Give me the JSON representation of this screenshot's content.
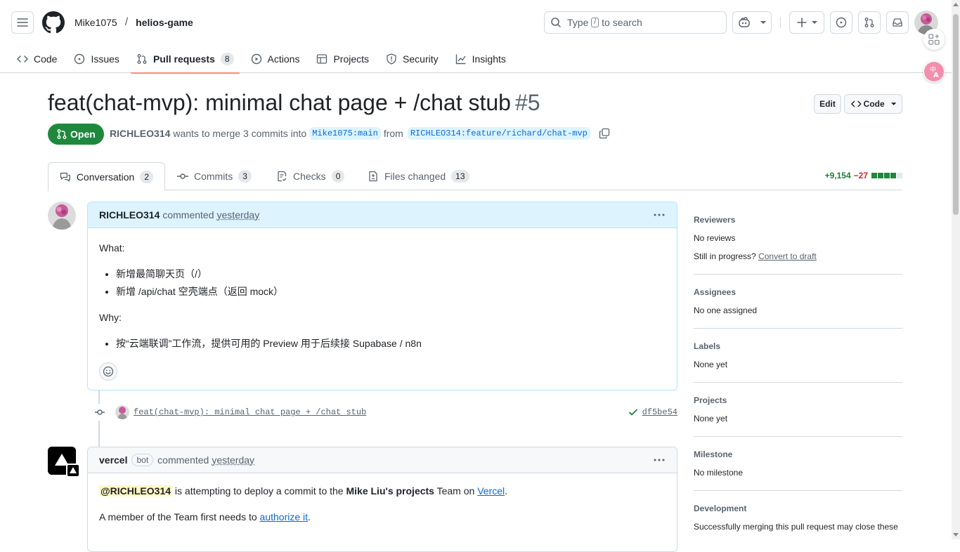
{
  "header": {
    "owner": "Mike1075",
    "separator": "/",
    "repo": "helios-game",
    "search": {
      "prefix": "Type",
      "key": "/",
      "suffix": "to search"
    }
  },
  "repo_tabs": [
    {
      "label": "Code",
      "icon": "code-icon"
    },
    {
      "label": "Issues",
      "icon": "issue-icon"
    },
    {
      "label": "Pull requests",
      "icon": "pull-request-icon",
      "count": "8",
      "active": true
    },
    {
      "label": "Actions",
      "icon": "play-icon"
    },
    {
      "label": "Projects",
      "icon": "table-icon"
    },
    {
      "label": "Security",
      "icon": "shield-icon"
    },
    {
      "label": "Insights",
      "icon": "graph-icon"
    }
  ],
  "pr": {
    "title": "feat(chat-mvp): minimal chat page + /chat stub",
    "number": "#5",
    "edit_label": "Edit",
    "code_label": "Code",
    "state": "Open",
    "author": "RICHLEO314",
    "merge_text": "wants to merge 3 commits into",
    "base_branch": "Mike1075:main",
    "from_text": "from",
    "head_branch": "RICHLEO314:feature/richard/chat-mvp"
  },
  "pr_tabs": {
    "conversation": {
      "label": "Conversation",
      "count": "2"
    },
    "commits": {
      "label": "Commits",
      "count": "3"
    },
    "checks": {
      "label": "Checks",
      "count": "0"
    },
    "files": {
      "label": "Files changed",
      "count": "13"
    },
    "additions": "+9,154",
    "deletions": "−27"
  },
  "comments": [
    {
      "author": "RICHLEO314",
      "action": "commented",
      "time": "yesterday",
      "what_label": "What:",
      "what_items": [
        "新增最简聊天页（/）",
        "新增 /api/chat 空壳端点（返回 mock）"
      ],
      "why_label": "Why:",
      "why_items": [
        "按“云端联调”工作流，提供可用的 Preview 用于后续接 Supabase / n8n"
      ]
    },
    {
      "author": "vercel",
      "badge": "bot",
      "action": "commented",
      "time": "yesterday",
      "mention": "@RICHLEO314",
      "line1_a": "is attempting to deploy a commit to the",
      "line1_team": "Mike Liu's projects",
      "line1_b": "Team on",
      "line1_link": "Vercel",
      "line1_end": ".",
      "line2_a": "A member of the Team first needs to",
      "line2_link": "authorize it",
      "line2_end": "."
    }
  ],
  "commit": {
    "message": "feat(chat-mvp): minimal chat page + /chat stub",
    "sha": "df5be54"
  },
  "sidebar": {
    "reviewers": {
      "heading": "Reviewers",
      "value": "No reviews",
      "draft_prefix": "Still in progress?",
      "draft_link": "Convert to draft"
    },
    "assignees": {
      "heading": "Assignees",
      "value": "No one assigned"
    },
    "labels": {
      "heading": "Labels",
      "value": "None yet"
    },
    "projects": {
      "heading": "Projects",
      "value": "None yet"
    },
    "milestone": {
      "heading": "Milestone",
      "value": "No milestone"
    },
    "development": {
      "heading": "Development",
      "value": "Successfully merging this pull request may close these"
    }
  },
  "colors": {
    "open_green": "#1f883d",
    "link_blue": "#0969da",
    "add_green": "#1a7f37",
    "del_red": "#d1242f",
    "active_tab_accent": "#fd8c73"
  }
}
